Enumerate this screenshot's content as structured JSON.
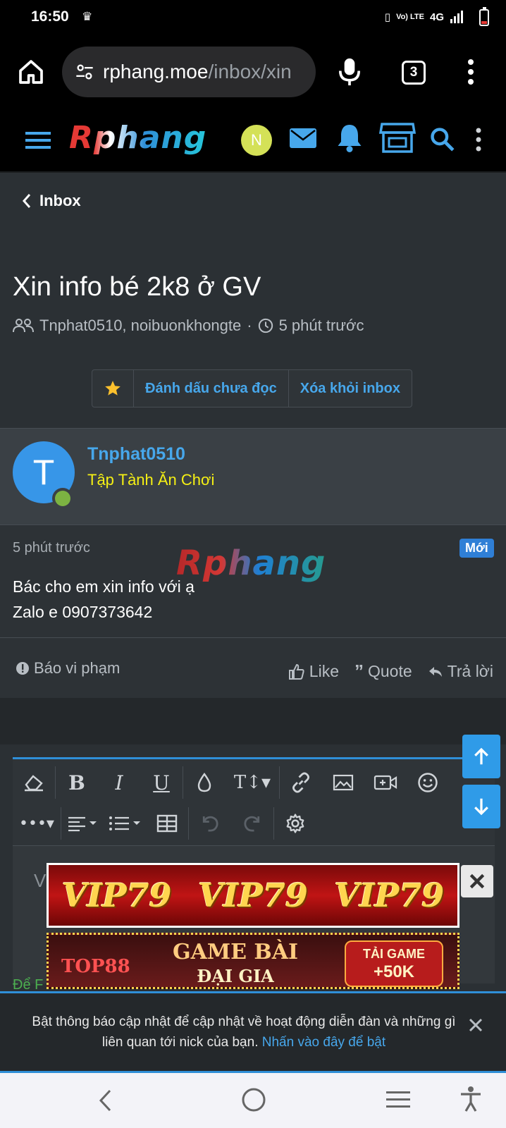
{
  "status_bar": {
    "time": "16:50",
    "network": "4G",
    "volte": "Vo) LTE"
  },
  "browser": {
    "url_host": "rphang.moe",
    "url_path": "/inbox/xin",
    "tab_count": "3"
  },
  "site": {
    "logo_text": "Rphang",
    "user_initial": "N"
  },
  "breadcrumb": {
    "label": "Inbox"
  },
  "thread": {
    "title": "Xin info bé 2k8 ở GV",
    "participants": "Tnphat0510, noibuonkhongte",
    "separator": "·",
    "time": "5 phút trước"
  },
  "buttons": {
    "mark_unread": "Đánh dấu chưa đọc",
    "remove_inbox": "Xóa khỏi inbox"
  },
  "post": {
    "avatar_letter": "T",
    "username": "Tnphat0510",
    "user_title": "Tập Tành Ăn Chơi",
    "time": "5 phút trước",
    "badge": "Mới",
    "watermark": "Rphang",
    "line1": "Bác cho em xin info với ạ",
    "line2": "Zalo e 0907373642"
  },
  "actions": {
    "report": "Báo vi phạm",
    "like": "Like",
    "quote": "Quote",
    "reply": "Trả lời"
  },
  "editor": {
    "placeholder_visible": "V"
  },
  "ads": {
    "banner1_text": "VIP79",
    "banner2_brand": "TOP88",
    "banner2_line1": "GAME BÀI",
    "banner2_line2": "ĐẠI GIA",
    "banner2_cta1": "TẢI GAME",
    "banner2_cta2": "+50K"
  },
  "partial_text": "Để F",
  "notice": {
    "text": "Bật thông báo cập nhật để cập nhật về hoạt động diễn đàn và những gì liên quan tới nick của bạn.",
    "link": "Nhấn vào đây để bật"
  },
  "colors": {
    "accent": "#47a7eb",
    "user_title": "#f5f014",
    "badge": "#2f7fd6",
    "background": "#2b3034"
  },
  "icons": [
    "home-icon",
    "tune-icon",
    "mic-icon",
    "more-vert-icon",
    "menu-icon",
    "mail-icon",
    "bell-icon",
    "store-icon",
    "search-icon",
    "chevron-left-icon",
    "users-icon",
    "clock-icon",
    "star-icon",
    "alert-icon",
    "thumb-up-icon",
    "quote-icon",
    "reply-icon",
    "eraser-icon",
    "bold-icon",
    "italic-icon",
    "underline-icon",
    "drop-icon",
    "text-size-icon",
    "link-icon",
    "image-icon",
    "video-icon",
    "smile-icon",
    "more-horiz-icon",
    "align-icon",
    "list-icon",
    "table-icon",
    "undo-icon",
    "redo-icon",
    "gear-icon",
    "arrow-up-icon",
    "arrow-down-icon",
    "close-icon",
    "back-icon",
    "home-circle-icon",
    "recents-icon",
    "accessibility-icon"
  ]
}
